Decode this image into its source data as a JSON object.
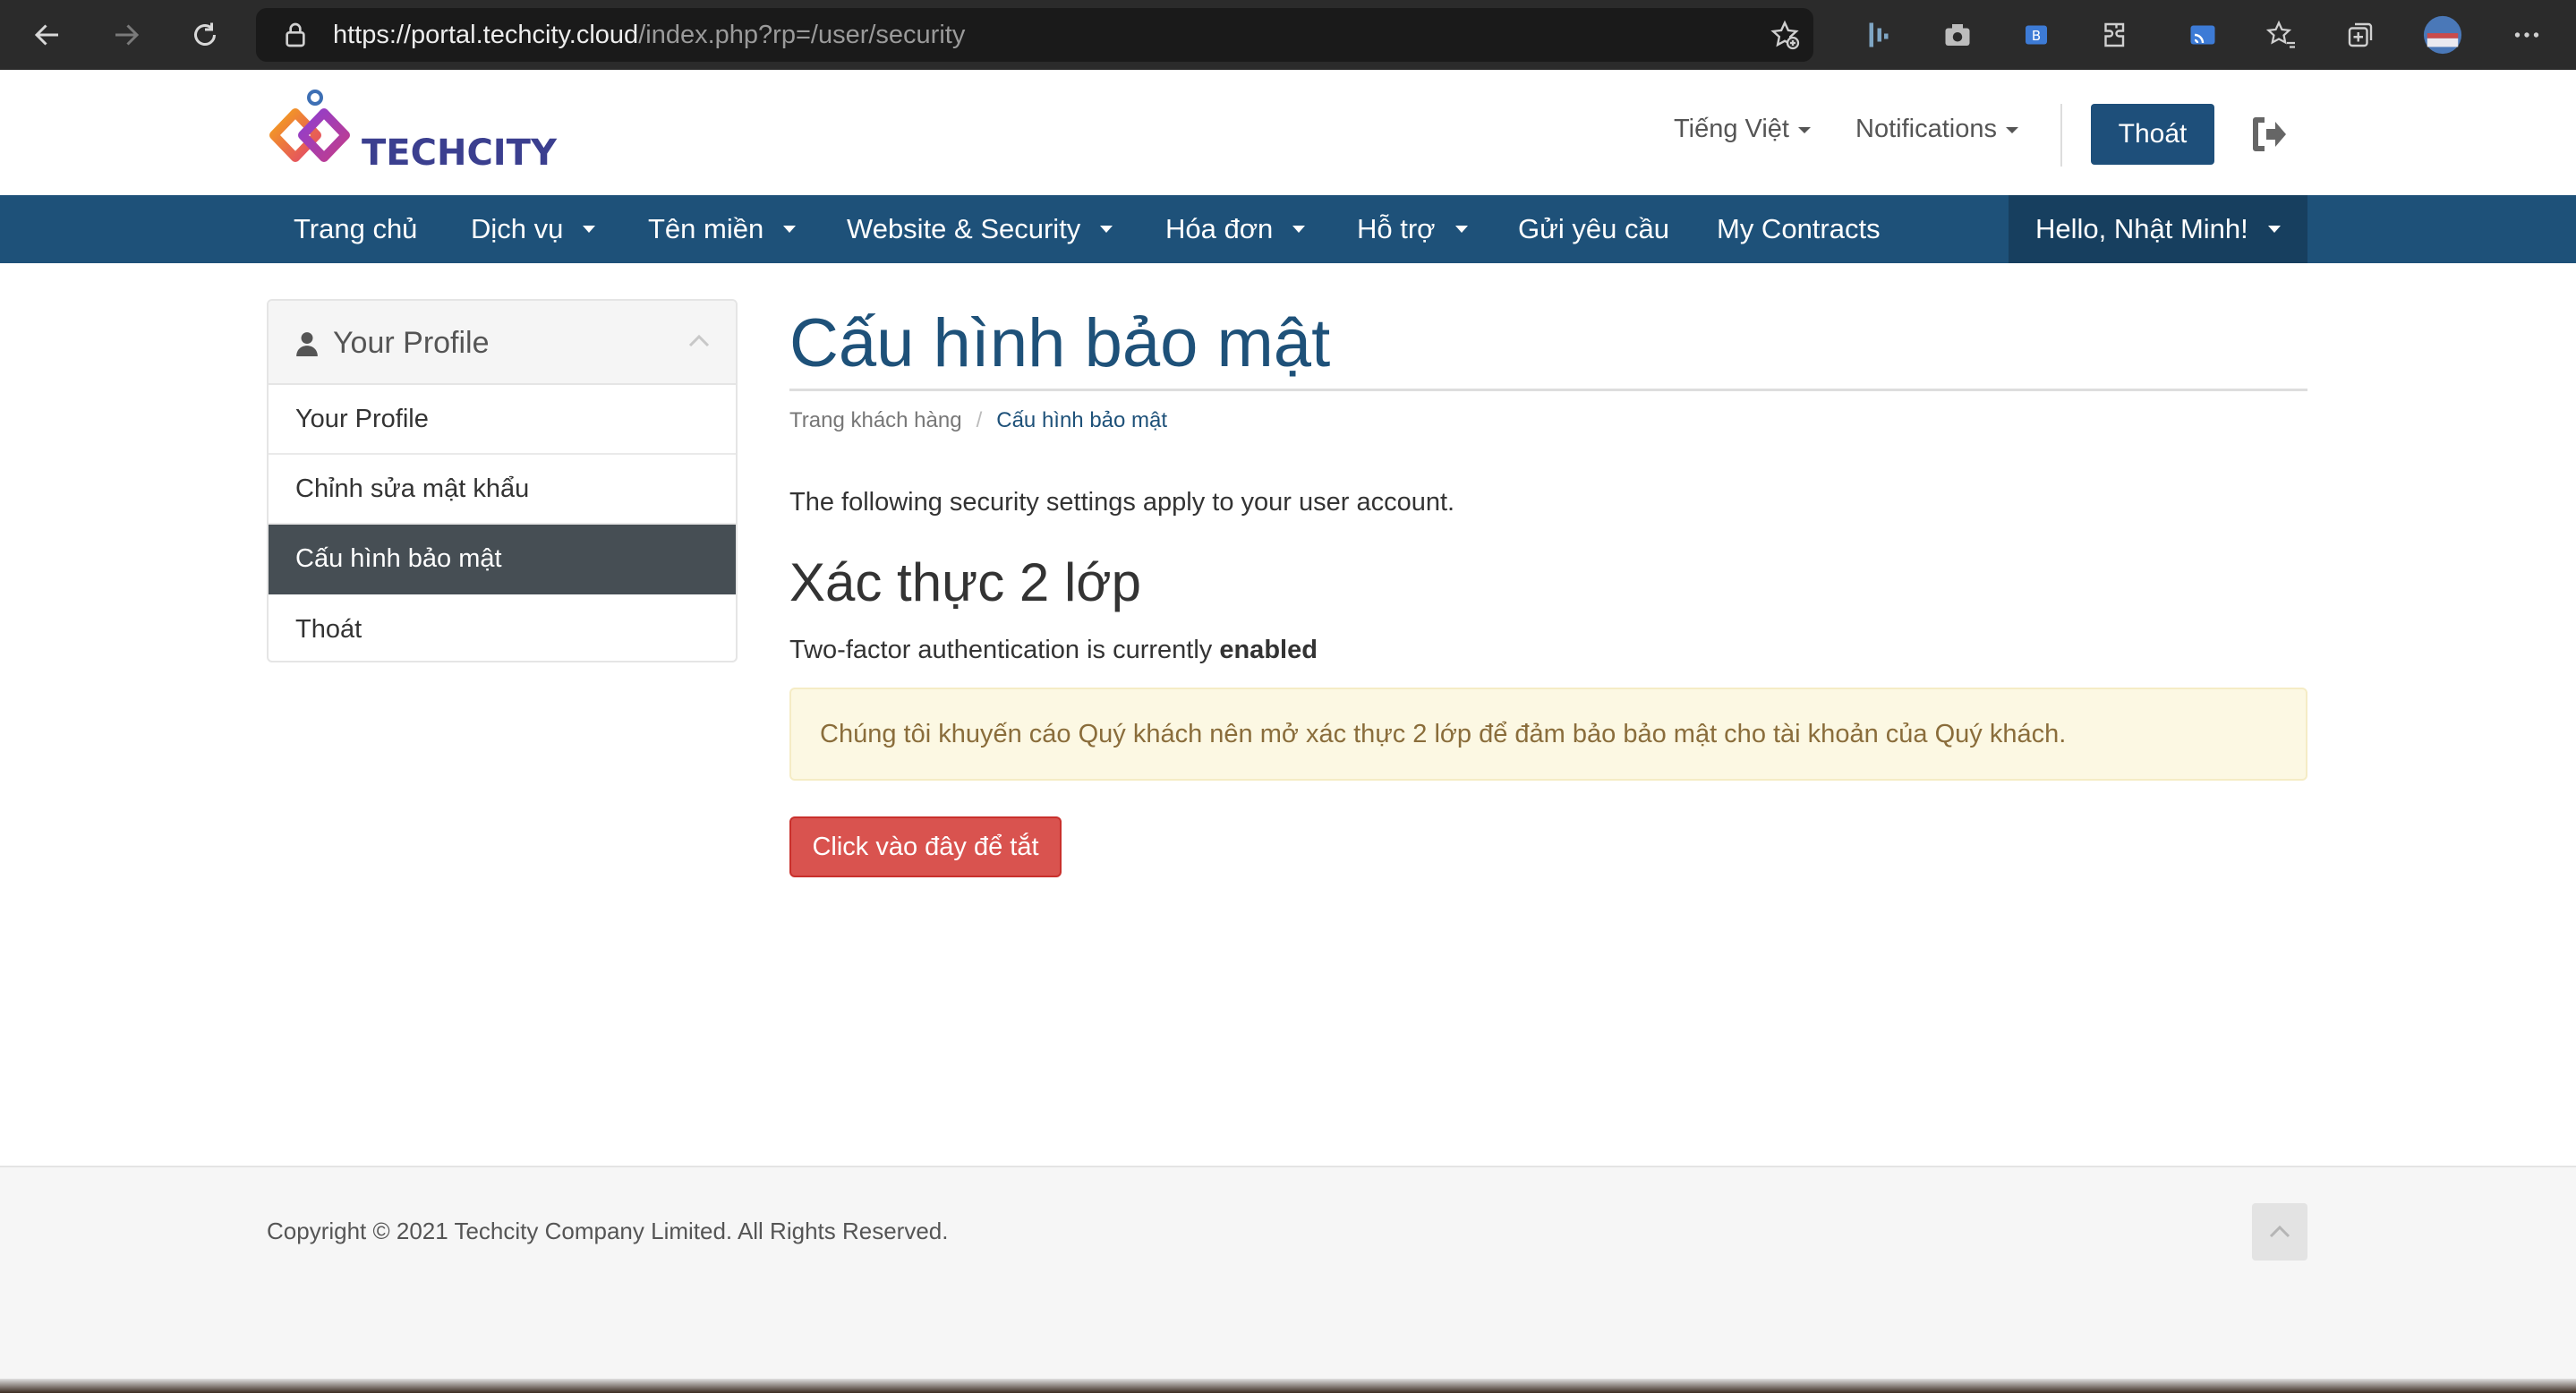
{
  "browser": {
    "url_host": "https://portal.techcity.cloud",
    "url_path": "/index.php?rp=/user/security"
  },
  "header": {
    "language": "Tiếng Việt",
    "notifications": "Notifications",
    "logout_label": "Thoát"
  },
  "nav": {
    "items": [
      "Trang chủ",
      "Dịch vụ",
      "Tên miền",
      "Website & Security",
      "Hóa đơn",
      "Hỗ trợ",
      "Gửi yêu cầu",
      "My Contracts"
    ],
    "user_greeting": "Hello, Nhật Minh!"
  },
  "sidebar": {
    "title": "Your Profile",
    "items": [
      "Your Profile",
      "Chỉnh sửa mật khẩu",
      "Cấu hình bảo mật",
      "Thoát"
    ],
    "active_index": 2
  },
  "content": {
    "title": "Cấu hình bảo mật",
    "breadcrumb": [
      "Trang khách hàng",
      "Cấu hình bảo mật"
    ],
    "breadcrumb_sep": "/",
    "intro": "The following security settings apply to your user account.",
    "twofa_heading": "Xác thực 2 lớp",
    "status_prefix": "Two-factor authentication is currently",
    "status_value": "enabled",
    "alert_text": "Chúng tôi khuyến cáo Quý khách nên mở xác thực 2 lớp để đảm bảo bảo mật cho tài khoản của Quý khách.",
    "disable_button": "Click vào đây để tắt"
  },
  "footer": {
    "copyright": "Copyright © 2021 Techcity Company Limited. All Rights Reserved."
  },
  "colors": {
    "brand_blue": "#1e5179",
    "danger": "#d9534f",
    "warning_bg": "#fcf8e3",
    "warning_text": "#8a6d3b"
  }
}
